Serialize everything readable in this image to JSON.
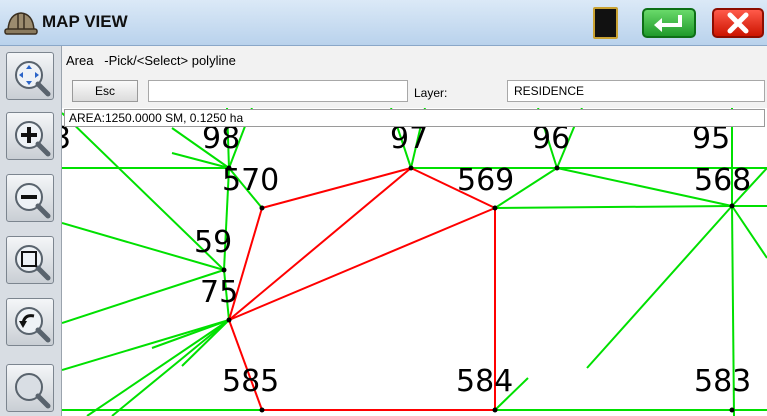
{
  "window": {
    "title": "MAP VIEW"
  },
  "command": {
    "prompt": "Area   -Pick/<Select> polyline",
    "esc_label": "Esc",
    "input_value": "",
    "layer_label": "Layer:",
    "layer_value": "RESIDENCE"
  },
  "map": {
    "area_readout": "AREA:1250.0000 SM, 0.1250 ha",
    "point_labels": [
      "98",
      "97",
      "96",
      "95",
      "570",
      "569",
      "568",
      "59",
      "75",
      "585",
      "584",
      "583",
      "3"
    ],
    "colors": {
      "linework": "#00e000",
      "selection": "#ff0000"
    }
  },
  "toolbar": {
    "tools": [
      "pan-tool-icon",
      "zoom-in-icon",
      "zoom-out-icon",
      "zoom-window-icon",
      "zoom-previous-icon",
      "zoom-extents-icon"
    ]
  }
}
